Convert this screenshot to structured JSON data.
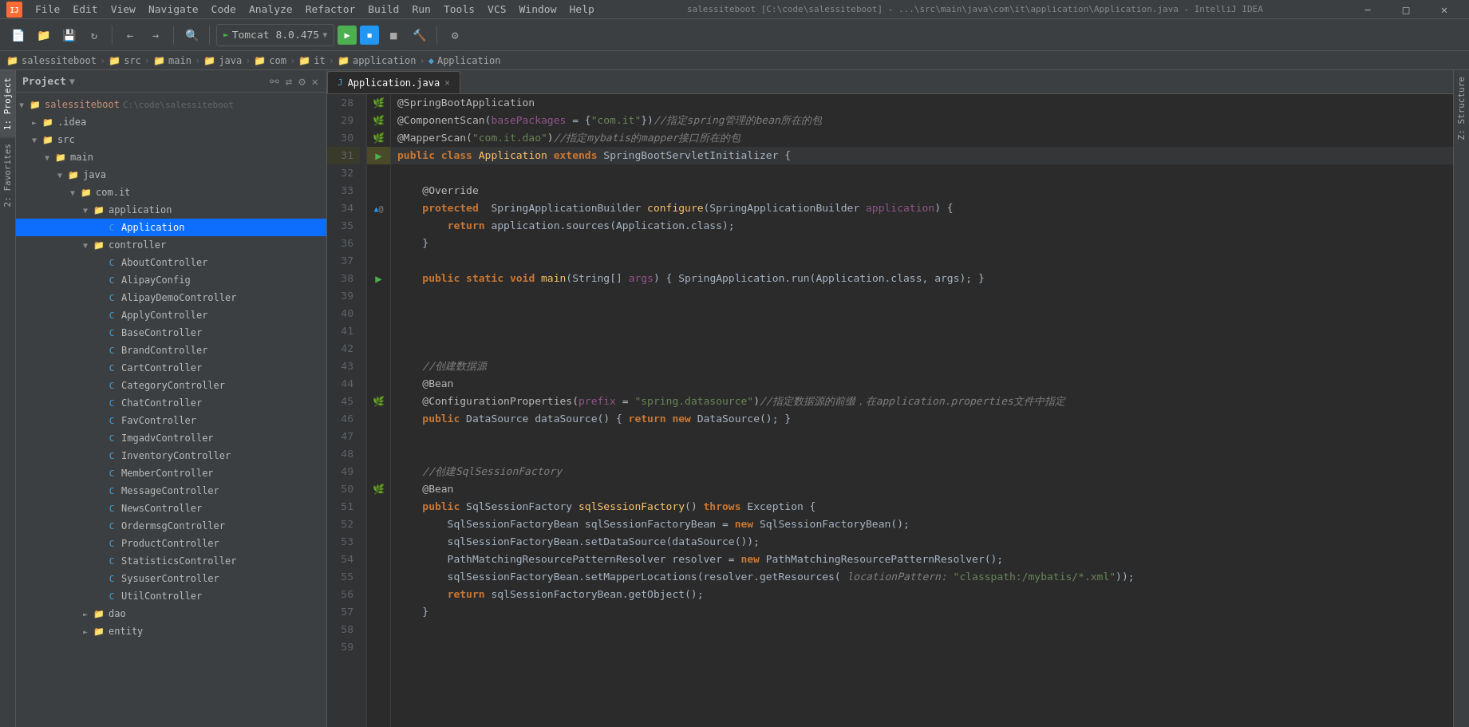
{
  "app": {
    "title": "salessiteboot [C:\\code\\salessiteboot] - ...\\src\\main\\java\\com\\it\\application\\Application.java - IntelliJ IDEA"
  },
  "menubar": {
    "items": [
      "File",
      "Edit",
      "View",
      "Navigate",
      "Code",
      "Analyze",
      "Refactor",
      "Build",
      "Run",
      "Tools",
      "VCS",
      "Window",
      "Help"
    ]
  },
  "toolbar": {
    "run_config": "Tomcat 8.0.475"
  },
  "breadcrumb": {
    "items": [
      "salessiteboot",
      "src",
      "main",
      "java",
      "com",
      "it",
      "application",
      "Application"
    ]
  },
  "tabs": {
    "editor_tab": "Application.java"
  },
  "project": {
    "title": "Project",
    "root": "salessiteboot",
    "root_path": "C:\\code\\salessiteboot",
    "tree": [
      {
        "label": ".idea",
        "type": "folder",
        "indent": 1,
        "expanded": false
      },
      {
        "label": "src",
        "type": "folder",
        "indent": 1,
        "expanded": true
      },
      {
        "label": "main",
        "type": "folder",
        "indent": 2,
        "expanded": true
      },
      {
        "label": "java",
        "type": "folder",
        "indent": 3,
        "expanded": true
      },
      {
        "label": "com.it",
        "type": "folder",
        "indent": 4,
        "expanded": true
      },
      {
        "label": "application",
        "type": "folder",
        "indent": 5,
        "expanded": true
      },
      {
        "label": "Application",
        "type": "java",
        "indent": 6,
        "selected": true
      },
      {
        "label": "controller",
        "type": "folder",
        "indent": 5,
        "expanded": true
      },
      {
        "label": "AboutController",
        "type": "java",
        "indent": 6
      },
      {
        "label": "AlipayConfig",
        "type": "java",
        "indent": 6
      },
      {
        "label": "AlipayDemoController",
        "type": "java",
        "indent": 6
      },
      {
        "label": "ApplyController",
        "type": "java",
        "indent": 6
      },
      {
        "label": "BaseController",
        "type": "java",
        "indent": 6
      },
      {
        "label": "BrandController",
        "type": "java",
        "indent": 6
      },
      {
        "label": "CartController",
        "type": "java",
        "indent": 6
      },
      {
        "label": "CategoryController",
        "type": "java",
        "indent": 6
      },
      {
        "label": "ChatController",
        "type": "java",
        "indent": 6
      },
      {
        "label": "FavController",
        "type": "java",
        "indent": 6
      },
      {
        "label": "ImgadvController",
        "type": "java",
        "indent": 6
      },
      {
        "label": "InventoryController",
        "type": "java",
        "indent": 6
      },
      {
        "label": "MemberController",
        "type": "java",
        "indent": 6
      },
      {
        "label": "MessageController",
        "type": "java",
        "indent": 6
      },
      {
        "label": "NewsController",
        "type": "java",
        "indent": 6
      },
      {
        "label": "OrdermsgController",
        "type": "java",
        "indent": 6
      },
      {
        "label": "ProductController",
        "type": "java",
        "indent": 6
      },
      {
        "label": "StatisticsController",
        "type": "java",
        "indent": 6
      },
      {
        "label": "SysuserController",
        "type": "java",
        "indent": 6
      },
      {
        "label": "UtilController",
        "type": "java",
        "indent": 6
      },
      {
        "label": "dao",
        "type": "folder",
        "indent": 4,
        "expanded": false
      },
      {
        "label": "entity",
        "type": "folder",
        "indent": 4,
        "expanded": false
      }
    ]
  },
  "side_tabs_left": [
    "1: Project",
    "2: Favorites"
  ],
  "side_tabs_right": [
    "Z: Structure"
  ],
  "code": {
    "lines": [
      {
        "num": 28,
        "content": "@SpringBootApplication",
        "type": "annotation"
      },
      {
        "num": 29,
        "content": "@ComponentScan(basePackages = {\"com.it\"})//指定spring管理的bean所在的包",
        "type": "annotation"
      },
      {
        "num": 30,
        "content": "@MapperScan(\"com.it.dao\")//指定mybatis的mapper接口所在的包",
        "type": "annotation"
      },
      {
        "num": 31,
        "content": "public class Application extends SpringBootServletInitializer {",
        "type": "highlighted"
      },
      {
        "num": 32,
        "content": "",
        "type": "normal"
      },
      {
        "num": 33,
        "content": "    @Override",
        "type": "normal"
      },
      {
        "num": 34,
        "content": "    protected SpringApplicationBuilder configure(SpringApplicationBuilder application) {",
        "type": "normal"
      },
      {
        "num": 35,
        "content": "        return application.sources(Application.class);",
        "type": "normal"
      },
      {
        "num": 36,
        "content": "    }",
        "type": "normal"
      },
      {
        "num": 37,
        "content": "",
        "type": "normal"
      },
      {
        "num": 38,
        "content": "    public static void main(String[] args) { SpringApplication.run(Application.class, args); }",
        "type": "normal"
      },
      {
        "num": 39,
        "content": "",
        "type": "normal"
      },
      {
        "num": 40,
        "content": "",
        "type": "normal"
      },
      {
        "num": 41,
        "content": "",
        "type": "normal"
      },
      {
        "num": 42,
        "content": "",
        "type": "normal"
      },
      {
        "num": 43,
        "content": "    //创建数据源",
        "type": "comment"
      },
      {
        "num": 44,
        "content": "    @Bean",
        "type": "annotation2"
      },
      {
        "num": 45,
        "content": "    @ConfigurationProperties(prefix = \"spring.datasource\")//指定数据源的前缀，在application.properties文件中指定",
        "type": "annotation2"
      },
      {
        "num": 46,
        "content": "    public DataSource dataSource() { return new DataSource(); }",
        "type": "normal"
      },
      {
        "num": 47,
        "content": "",
        "type": "normal"
      },
      {
        "num": 48,
        "content": "",
        "type": "normal"
      },
      {
        "num": 49,
        "content": "    //创建SqlSessionFactory",
        "type": "comment"
      },
      {
        "num": 50,
        "content": "    @Bean",
        "type": "annotation2"
      },
      {
        "num": 51,
        "content": "    public SqlSessionFactory sqlSessionFactory() throws Exception {",
        "type": "normal"
      },
      {
        "num": 52,
        "content": "        SqlSessionFactoryBean sqlSessionFactoryBean = new SqlSessionFactoryBean();",
        "type": "normal"
      },
      {
        "num": 53,
        "content": "        sqlSessionFactoryBean.setDataSource(dataSource());",
        "type": "normal"
      },
      {
        "num": 54,
        "content": "        PathMatchingResourcePatternResolver resolver = new PathMatchingResourcePatternResolver();",
        "type": "normal"
      },
      {
        "num": 55,
        "content": "        sqlSessionFactoryBean.setMapperLocations(resolver.getResources( locationPattern: \"classpath:/mybatis/*.xml\"));",
        "type": "normal"
      },
      {
        "num": 56,
        "content": "        return sqlSessionFactoryBean.getObject();",
        "type": "normal"
      },
      {
        "num": 57,
        "content": "    }",
        "type": "normal"
      },
      {
        "num": 58,
        "content": "",
        "type": "normal"
      },
      {
        "num": 59,
        "content": "",
        "type": "normal"
      }
    ]
  }
}
